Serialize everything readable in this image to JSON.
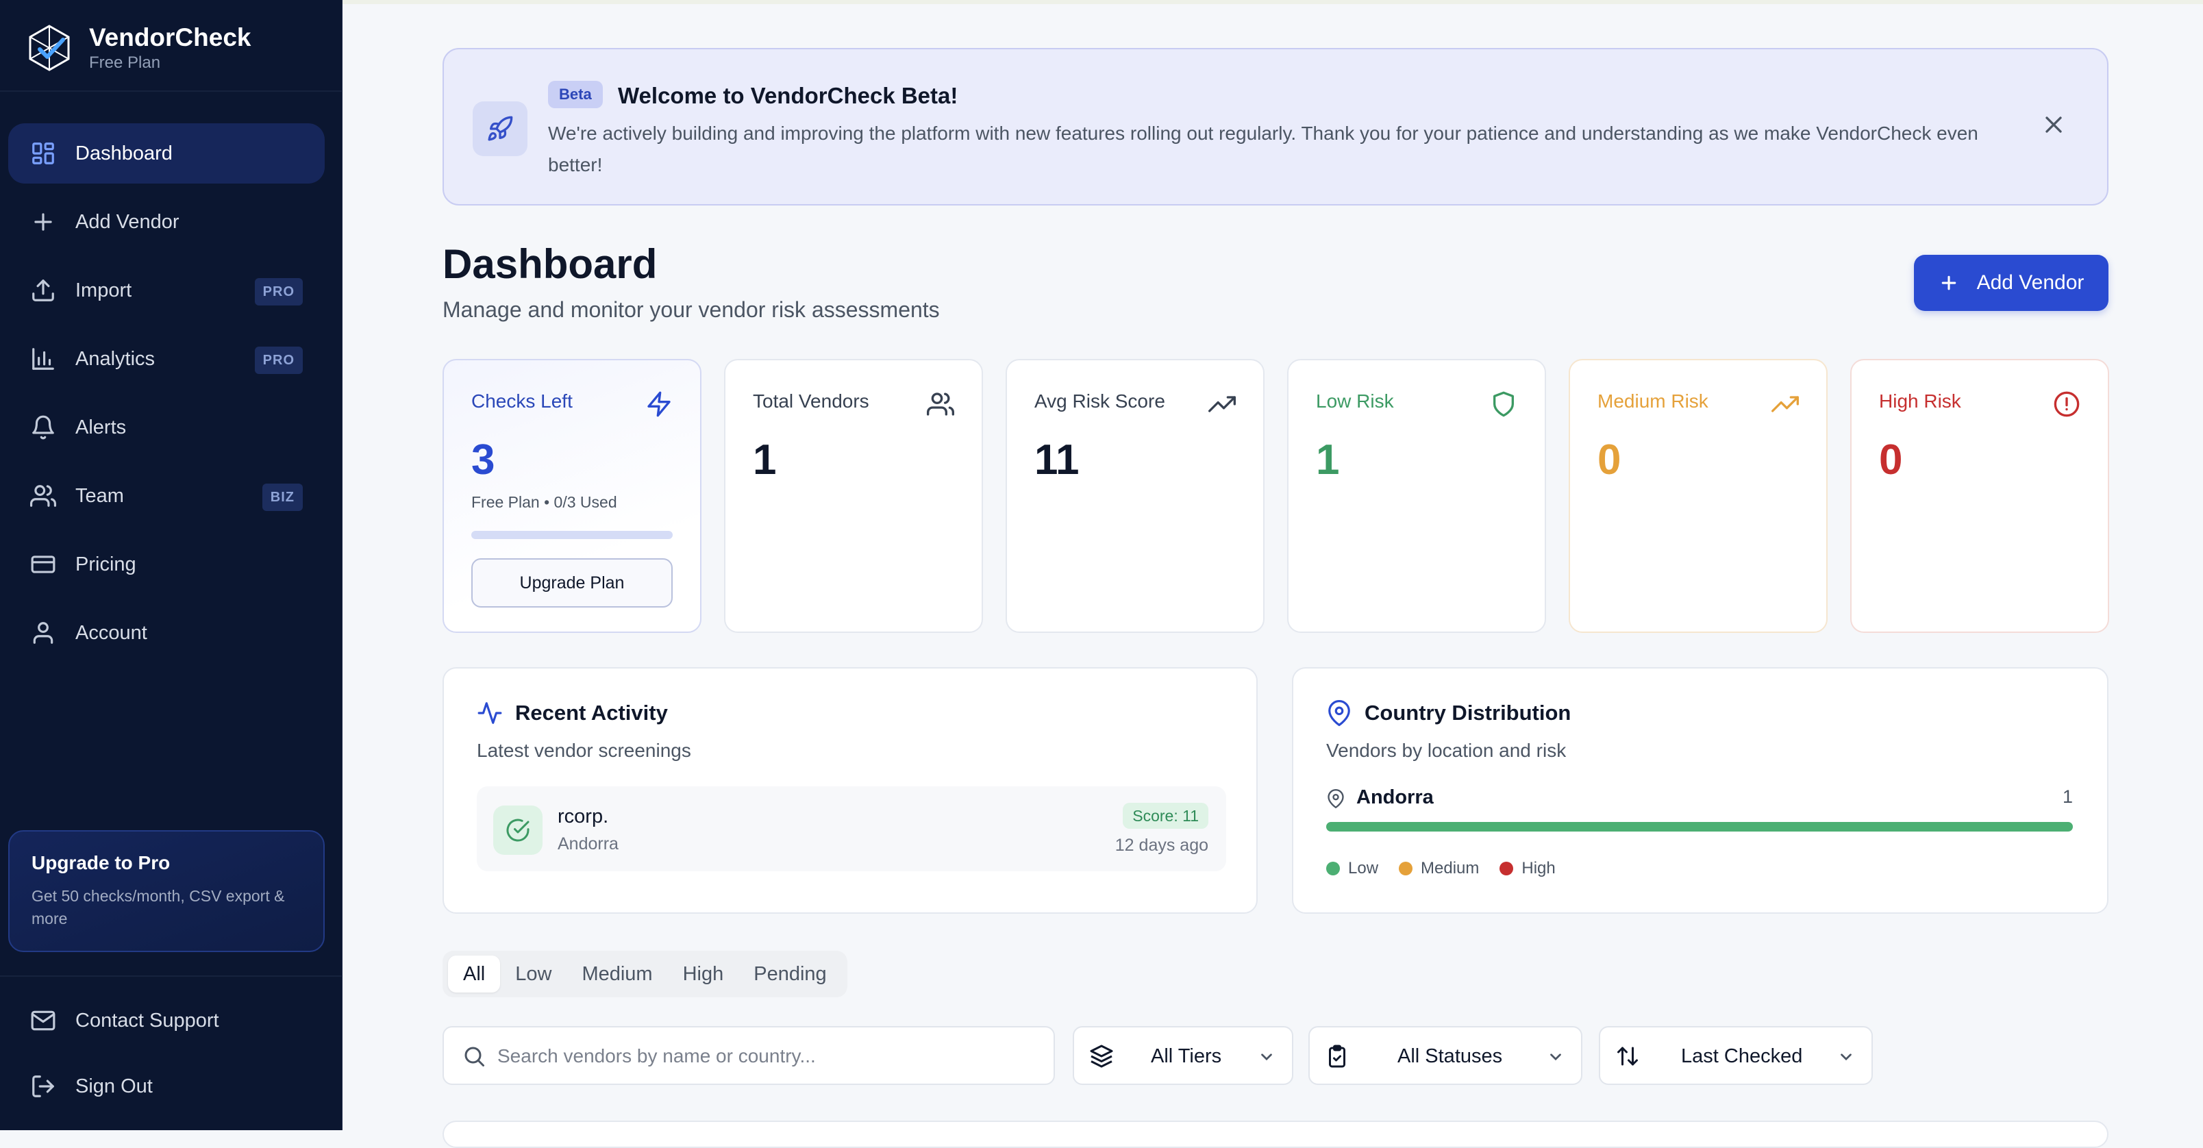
{
  "brand": {
    "name": "VendorCheck",
    "plan": "Free Plan"
  },
  "sidebar": {
    "items": [
      {
        "label": "Dashboard",
        "icon": "dashboard-icon",
        "active": true
      },
      {
        "label": "Add Vendor",
        "icon": "plus-icon"
      },
      {
        "label": "Import",
        "icon": "upload-icon",
        "badge": "PRO"
      },
      {
        "label": "Analytics",
        "icon": "bar-chart-icon",
        "badge": "PRO"
      },
      {
        "label": "Alerts",
        "icon": "bell-icon"
      },
      {
        "label": "Team",
        "icon": "users-icon",
        "badge": "BIZ"
      },
      {
        "label": "Pricing",
        "icon": "credit-card-icon"
      },
      {
        "label": "Account",
        "icon": "user-icon"
      }
    ],
    "upgrade": {
      "title": "Upgrade to Pro",
      "description": "Get 50 checks/month, CSV export & more"
    },
    "bottom_items": [
      {
        "label": "Contact Support",
        "icon": "mail-icon"
      },
      {
        "label": "Sign Out",
        "icon": "sign-out-icon"
      }
    ]
  },
  "banner": {
    "badge": "Beta",
    "title": "Welcome to VendorCheck Beta!",
    "text": "We're actively building and improving the platform with new features rolling out regularly. Thank you for your patience and understanding as we make VendorCheck even better!"
  },
  "header": {
    "title": "Dashboard",
    "subtitle": "Manage and monitor your vendor risk assessments",
    "add_button": "Add Vendor"
  },
  "stats": {
    "checks_left": {
      "label": "Checks Left",
      "value": "3",
      "sub": "Free Plan • 0/3 Used",
      "used_fraction": 0,
      "button": "Upgrade Plan"
    },
    "total_vendors": {
      "label": "Total Vendors",
      "value": "1"
    },
    "avg_risk": {
      "label": "Avg Risk Score",
      "value": "11"
    },
    "low_risk": {
      "label": "Low Risk",
      "value": "1"
    },
    "medium_risk": {
      "label": "Medium Risk",
      "value": "0"
    },
    "high_risk": {
      "label": "High Risk",
      "value": "0"
    }
  },
  "recent_activity": {
    "title": "Recent Activity",
    "subtitle": "Latest vendor screenings",
    "items": [
      {
        "name": "rcorp.",
        "country": "Andorra",
        "score": "Score: 11",
        "time": "12 days ago"
      }
    ]
  },
  "country_distribution": {
    "title": "Country Distribution",
    "subtitle": "Vendors by location and risk",
    "rows": [
      {
        "country": "Andorra",
        "count": "1",
        "low": 1,
        "medium": 0,
        "high": 0
      }
    ],
    "legend": {
      "low": "Low",
      "medium": "Medium",
      "high": "High"
    }
  },
  "filters": {
    "tabs": [
      "All",
      "Low",
      "Medium",
      "High",
      "Pending"
    ],
    "active_tab": "All",
    "search_placeholder": "Search vendors by name or country...",
    "tier": "All Tiers",
    "status": "All Statuses",
    "sort": "Last Checked"
  },
  "colors": {
    "sidebar": "#0b1630",
    "accent": "#2a4bd1",
    "low": "#3c9a63",
    "medium": "#e5a13a",
    "high": "#c62f2f"
  }
}
